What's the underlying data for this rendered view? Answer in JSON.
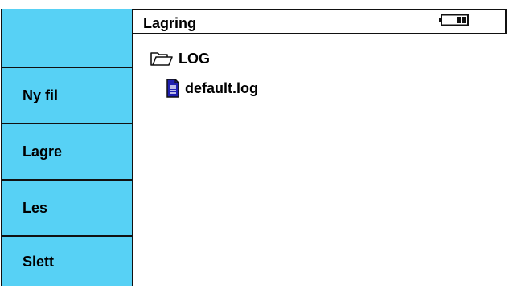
{
  "sidebar": {
    "items": [
      {
        "label": "Ny fil"
      },
      {
        "label": "Lagre"
      },
      {
        "label": "Les"
      },
      {
        "label": "Slett"
      }
    ]
  },
  "header": {
    "title": "Lagring",
    "battery_icon": "battery-icon"
  },
  "file_tree": {
    "folder": {
      "label": "LOG",
      "icon": "folder-open-icon"
    },
    "files": [
      {
        "label": "default.log",
        "icon": "document-icon"
      }
    ]
  },
  "colors": {
    "sidebar_bg": "#57d1f5",
    "document_icon": "#1f1fb0",
    "border": "#111111"
  }
}
